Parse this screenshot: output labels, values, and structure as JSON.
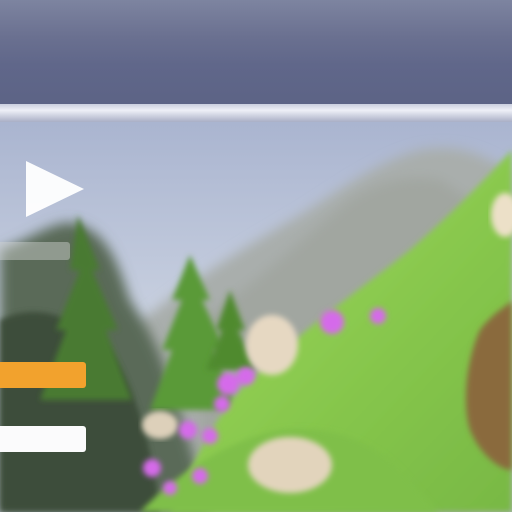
{
  "scene": {
    "description_icon": "landscape-background",
    "sky_color": "#b8c3d9",
    "hill_color": "#8ccf52",
    "tree_color": "#4f8a2f",
    "flower_color": "#d56bea",
    "rock_color": "#e4d6c0"
  },
  "top_bar": {
    "color": "#646a8c"
  },
  "play_button": {
    "icon": "play-icon",
    "color": "#ffffff"
  },
  "menu": {
    "bars": [
      {
        "color": "#f2a22d"
      },
      {
        "color": "#fbfbfc"
      }
    ]
  }
}
